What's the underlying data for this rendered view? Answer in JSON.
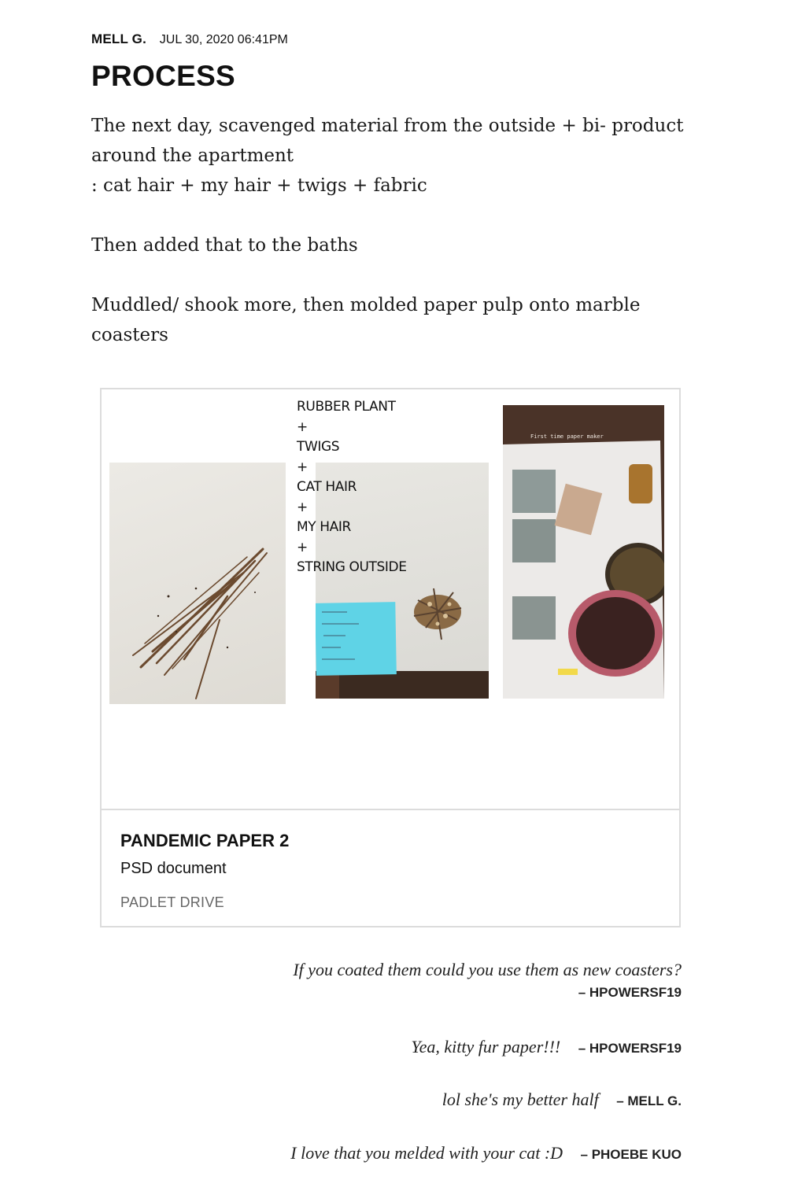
{
  "post": {
    "author": "MELL G.",
    "date": "JUL 30, 2020 06:41PM",
    "title": "PROCESS",
    "paragraphs": [
      "The next day, scavenged material from the outside + bi- product around the apartment",
      ": cat hair + my hair + twigs + fabric",
      "Then added that to the baths",
      "Muddled/ shook more, then molded paper pulp onto marble coasters"
    ]
  },
  "attachment": {
    "title": "PANDEMIC PAPER 2",
    "type": "PSD document",
    "source": "PADLET DRIVE",
    "preview_labels": [
      "RUBBER PLANT",
      "+",
      "TWIGS",
      "+",
      "CAT HAIR",
      "+",
      "MY HAIR",
      "+",
      "STRING OUTSIDE"
    ],
    "photo_caption": "First time paper maker"
  },
  "comments": [
    {
      "text": "If you coated them could you use them as new coasters?",
      "author": "– HPOWERSF19"
    },
    {
      "text": "Yea, kitty fur paper!!!",
      "author": "– HPOWERSF19"
    },
    {
      "text": "lol she's my better half",
      "author": "– MELL G."
    },
    {
      "text": "I love that you melded with your cat :D",
      "author": "– PHOEBE KUO"
    }
  ]
}
